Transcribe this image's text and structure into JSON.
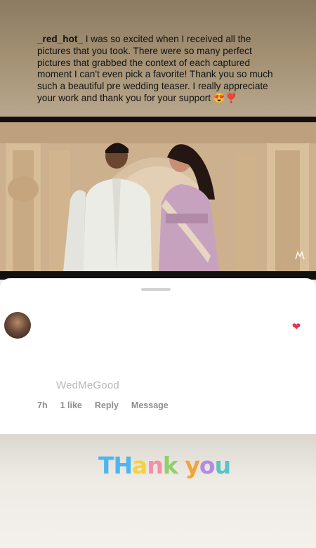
{
  "comment": {
    "username": "_red_hot_",
    "text": " I was so excited when I received all the pictures that you took. There were so many perfect pictures that grabbed the context of each captured moment I can't even pick a favorite! Thank you so much such a beautiful pre wedding teaser. I really appreciate your work and thank you for your support 😍❣️",
    "time": "7h",
    "likes": "1 like",
    "reply_label": "Reply",
    "message_label": "Message",
    "watermark": "WedMeGood"
  },
  "sticker": {
    "letters": [
      "T",
      "H",
      "a",
      "n",
      "k",
      " ",
      "y",
      "o",
      "u"
    ],
    "colors": [
      "#4bb6f0",
      "#4bb6f0",
      "#f6d23f",
      "#f28fa6",
      "#8fd16a",
      " ",
      "#f2a43a",
      "#b58ae3",
      "#58c4c6"
    ]
  },
  "icons": {
    "heart": "heart-icon",
    "video_logo": "watermark-logo-icon"
  }
}
